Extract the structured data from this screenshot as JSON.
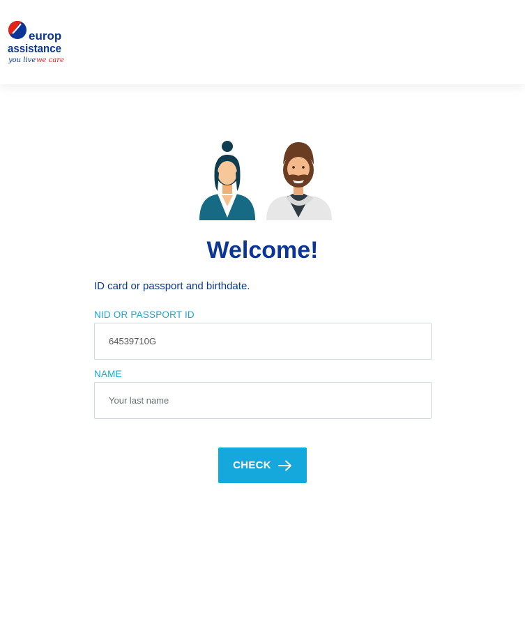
{
  "brand": {
    "line1": "europ",
    "line2": "assistance",
    "tagline_a": "you live",
    "tagline_b": "we care"
  },
  "main": {
    "title": "Welcome!",
    "subtitle": "ID card or passport and birthdate."
  },
  "form": {
    "nid": {
      "label": "NID OR PASSPORT ID",
      "value": "64539710G"
    },
    "name": {
      "label": "NAME",
      "placeholder": "Your last name",
      "value": ""
    },
    "submit_label": "CHECK"
  },
  "colors": {
    "brand_blue": "#0b3596",
    "accent_cyan": "#14a8dc",
    "brand_red": "#e2231a"
  },
  "icons": [
    "europ-assistance-logo",
    "woman-avatar-icon",
    "man-avatar-icon",
    "arrow-right-icon"
  ]
}
